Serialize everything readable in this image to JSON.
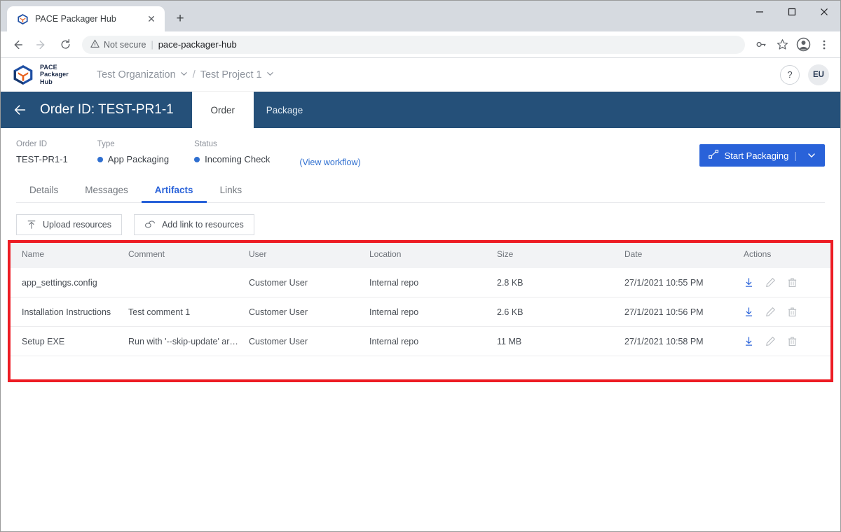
{
  "browser": {
    "tab": {
      "title": "PACE Packager Hub",
      "favicon_icon": "pace-cube-icon",
      "close_icon": "close-icon"
    },
    "new_tab_label": "+",
    "window_controls": {
      "minimize": "minimize-icon",
      "maximize": "maximize-icon",
      "close": "close-icon"
    },
    "nav": {
      "back": "back-arrow-icon",
      "forward": "forward-arrow-icon",
      "reload": "reload-icon"
    },
    "omnibox": {
      "security_label": "Not secure",
      "security_icon": "warning-triangle-icon",
      "separator": "|",
      "url": "pace-packager-hub"
    },
    "toolbar_icons": [
      "key-icon",
      "star-icon",
      "profile-avatar-icon",
      "more-vertical-icon"
    ]
  },
  "app": {
    "logo": {
      "line1": "PACE",
      "line2": "Packager",
      "line3": "Hub"
    },
    "breadcrumb": {
      "organization": "Test Organization",
      "separator": "/",
      "project": "Test Project 1"
    },
    "help_label": "?",
    "avatar_initials": "EU"
  },
  "order_header": {
    "back_icon": "back-arrow-icon",
    "title": "Order ID: TEST-PR1-1",
    "tabs": [
      {
        "label": "Order",
        "active": true
      },
      {
        "label": "Package",
        "active": false
      }
    ]
  },
  "meta": {
    "order_id": {
      "label": "Order ID",
      "value": "TEST-PR1-1"
    },
    "type": {
      "label": "Type",
      "value": "App Packaging",
      "dot_color": "#2f6fd0"
    },
    "status": {
      "label": "Status",
      "value": "Incoming Check",
      "dot_color": "#2f6fd0"
    },
    "workflow_link": "(View workflow)",
    "primary_button": {
      "label": "Start Packaging",
      "icon": "workflow-nodes-icon",
      "separator": "|",
      "caret_icon": "chevron-down-icon",
      "color": "#2962d9"
    }
  },
  "sub_tabs": [
    {
      "label": "Details",
      "active": false
    },
    {
      "label": "Messages",
      "active": false
    },
    {
      "label": "Artifacts",
      "active": true
    },
    {
      "label": "Links",
      "active": false
    }
  ],
  "resource_toolbar": [
    {
      "label": "Upload resources",
      "icon": "upload-icon"
    },
    {
      "label": "Add link to resources",
      "icon": "link-chain-icon"
    }
  ],
  "table": {
    "columns": [
      "Name",
      "Comment",
      "User",
      "Location",
      "Size",
      "Date",
      "Actions"
    ],
    "rows": [
      {
        "name": "app_settings.config",
        "comment": "",
        "user": "Customer User",
        "location": "Internal repo",
        "size": "2.8 KB",
        "date": "27/1/2021 10:55 PM"
      },
      {
        "name": "Installation Instructions",
        "comment": "Test comment 1",
        "user": "Customer User",
        "location": "Internal repo",
        "size": "2.6 KB",
        "date": "27/1/2021 10:56 PM"
      },
      {
        "name": "Setup EXE",
        "comment": "Run with '--skip-update' argu...",
        "user": "Customer User",
        "location": "Internal repo",
        "size": "11 MB",
        "date": "27/1/2021 10:58 PM"
      }
    ],
    "row_actions": [
      {
        "name": "download",
        "icon": "download-icon"
      },
      {
        "name": "edit",
        "icon": "pencil-icon"
      },
      {
        "name": "delete",
        "icon": "trash-icon"
      }
    ]
  },
  "annotation": {
    "highlight_color": "#ed1c24"
  }
}
